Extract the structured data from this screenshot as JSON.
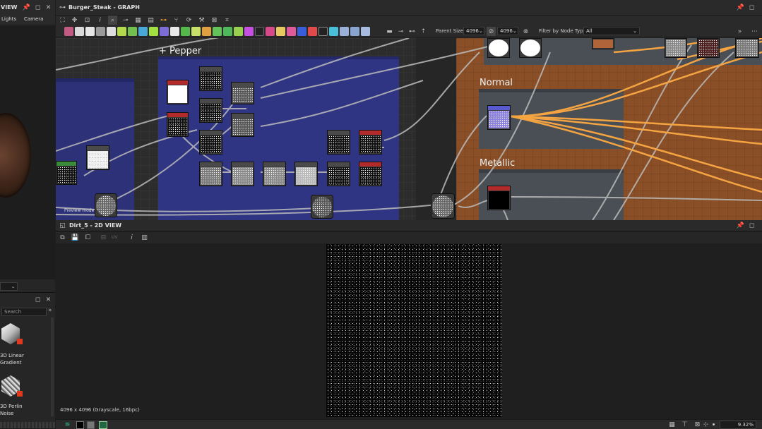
{
  "left_panel": {
    "title": "VIEW",
    "tabs": [
      "Lights",
      "Camera"
    ],
    "dropdown_value": "",
    "library": {
      "search_placeholder": "Search",
      "items": [
        {
          "label": "3D Linear Gradient",
          "icon": "cube-gradient-icon"
        },
        {
          "label": "3D Perlin Noise",
          "icon": "cube-noise-icon"
        }
      ]
    }
  },
  "graph": {
    "title": "Burger_Steak - GRAPH",
    "parent_size_label": "Parent Size:",
    "parent_size_value": "4096",
    "size_value": "4096",
    "filter_label": "Filter by Node Type",
    "filter_value": "All",
    "frames": [
      {
        "title": "+ Pepper"
      },
      {
        "title": "Normal"
      },
      {
        "title": "Metallic"
      }
    ],
    "preview_mode_label": "Preview mode",
    "colors": {
      "pepper_frame": "#2f3582",
      "left_frame": "#2d3278",
      "orange_bg": "#8a4f26",
      "wire_orange": "#f5a442",
      "wire_gray": "#bcbcbc"
    }
  },
  "view2d": {
    "title": "Dirt_5 - 2D VIEW",
    "toolbar_uv": "UV",
    "status": "4096 x 4096 (Grayscale, 16bpc)",
    "zoom": "9.32%"
  }
}
